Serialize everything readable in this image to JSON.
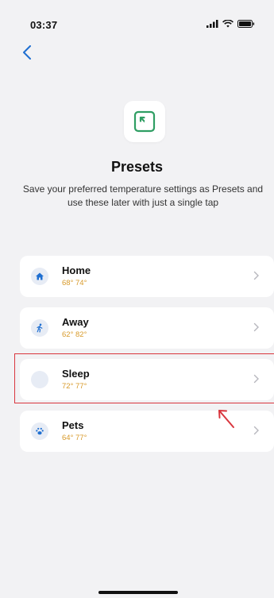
{
  "status_bar": {
    "time": "03:37"
  },
  "header": {
    "title": "Presets",
    "subtitle": "Save your preferred temperature settings as Presets and use these later with just a single tap"
  },
  "presets": [
    {
      "name": "Home",
      "temps": "68° 74°",
      "icon": "home-icon"
    },
    {
      "name": "Away",
      "temps": "62° 82°",
      "icon": "walking-person-icon"
    },
    {
      "name": "Sleep",
      "temps": "72° 77°",
      "icon": "moon-icon"
    },
    {
      "name": "Pets",
      "temps": "64° 77°",
      "icon": "paw-icon"
    }
  ],
  "colors": {
    "accent": "#2f9e63",
    "primary_blue": "#1f6fd1",
    "temps": "#d89a2a",
    "highlight": "#d9363e"
  }
}
